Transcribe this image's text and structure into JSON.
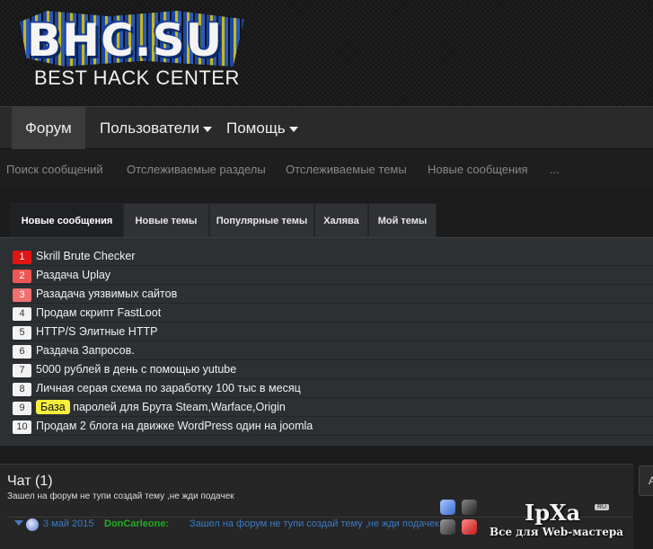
{
  "logo": {
    "main": "BHC.SU",
    "sub": "BEST HACK CENTER"
  },
  "nav": {
    "forum": "Форум",
    "users": "Пользователи",
    "help": "Помощь"
  },
  "subnav": [
    "Поиск сообщений",
    "Отслеживаемые разделы",
    "Отслеживаемые темы",
    "Новые сообщения",
    "..."
  ],
  "tabs": [
    "Новые сообщения",
    "Новые темы",
    "Популярные темы",
    "Халява",
    "Мой темы"
  ],
  "threads": [
    {
      "num": "1",
      "title": "Skrill Brute Checker"
    },
    {
      "num": "2",
      "title": "Раздача Uplay"
    },
    {
      "num": "3",
      "title": "Разадача уязвимых сайтов"
    },
    {
      "num": "4",
      "title": "Продам скрипт FastLoot"
    },
    {
      "num": "5",
      "title": "HTTP/S Элитные HTTP"
    },
    {
      "num": "6",
      "title": "Раздача Запросов."
    },
    {
      "num": "7",
      "title": "5000 рублей в день с помощью yutube"
    },
    {
      "num": "8",
      "title": "Личная серая схема по заработку 100 тыс в месяц"
    },
    {
      "num": "9",
      "highlight": "База",
      "title": "паролей для Брута Steam,Warface,Origin"
    },
    {
      "num": "10",
      "title": "Продам 2 блога на движке WordPress один на joomla"
    }
  ],
  "chat": {
    "title": "Чат (1)",
    "subtitle": "Зашел на форум не тупи создай тему ,не жди подачек",
    "message": {
      "date": "3 май 2015",
      "user": "DonCarleone:",
      "text": "Зашел на форум не тупи создай тему ,не жди подачек"
    }
  },
  "side_button": "А",
  "watermark": {
    "title": "IpXa",
    "badge": "RU",
    "subtitle": "Все для Web-мастера"
  },
  "colors": {
    "badge_red": "#e01515",
    "badge_pink": "#ee5555",
    "highlight": "#f5ef3d",
    "chat_link": "#3a7ac6",
    "chat_user": "#1fae1f"
  }
}
